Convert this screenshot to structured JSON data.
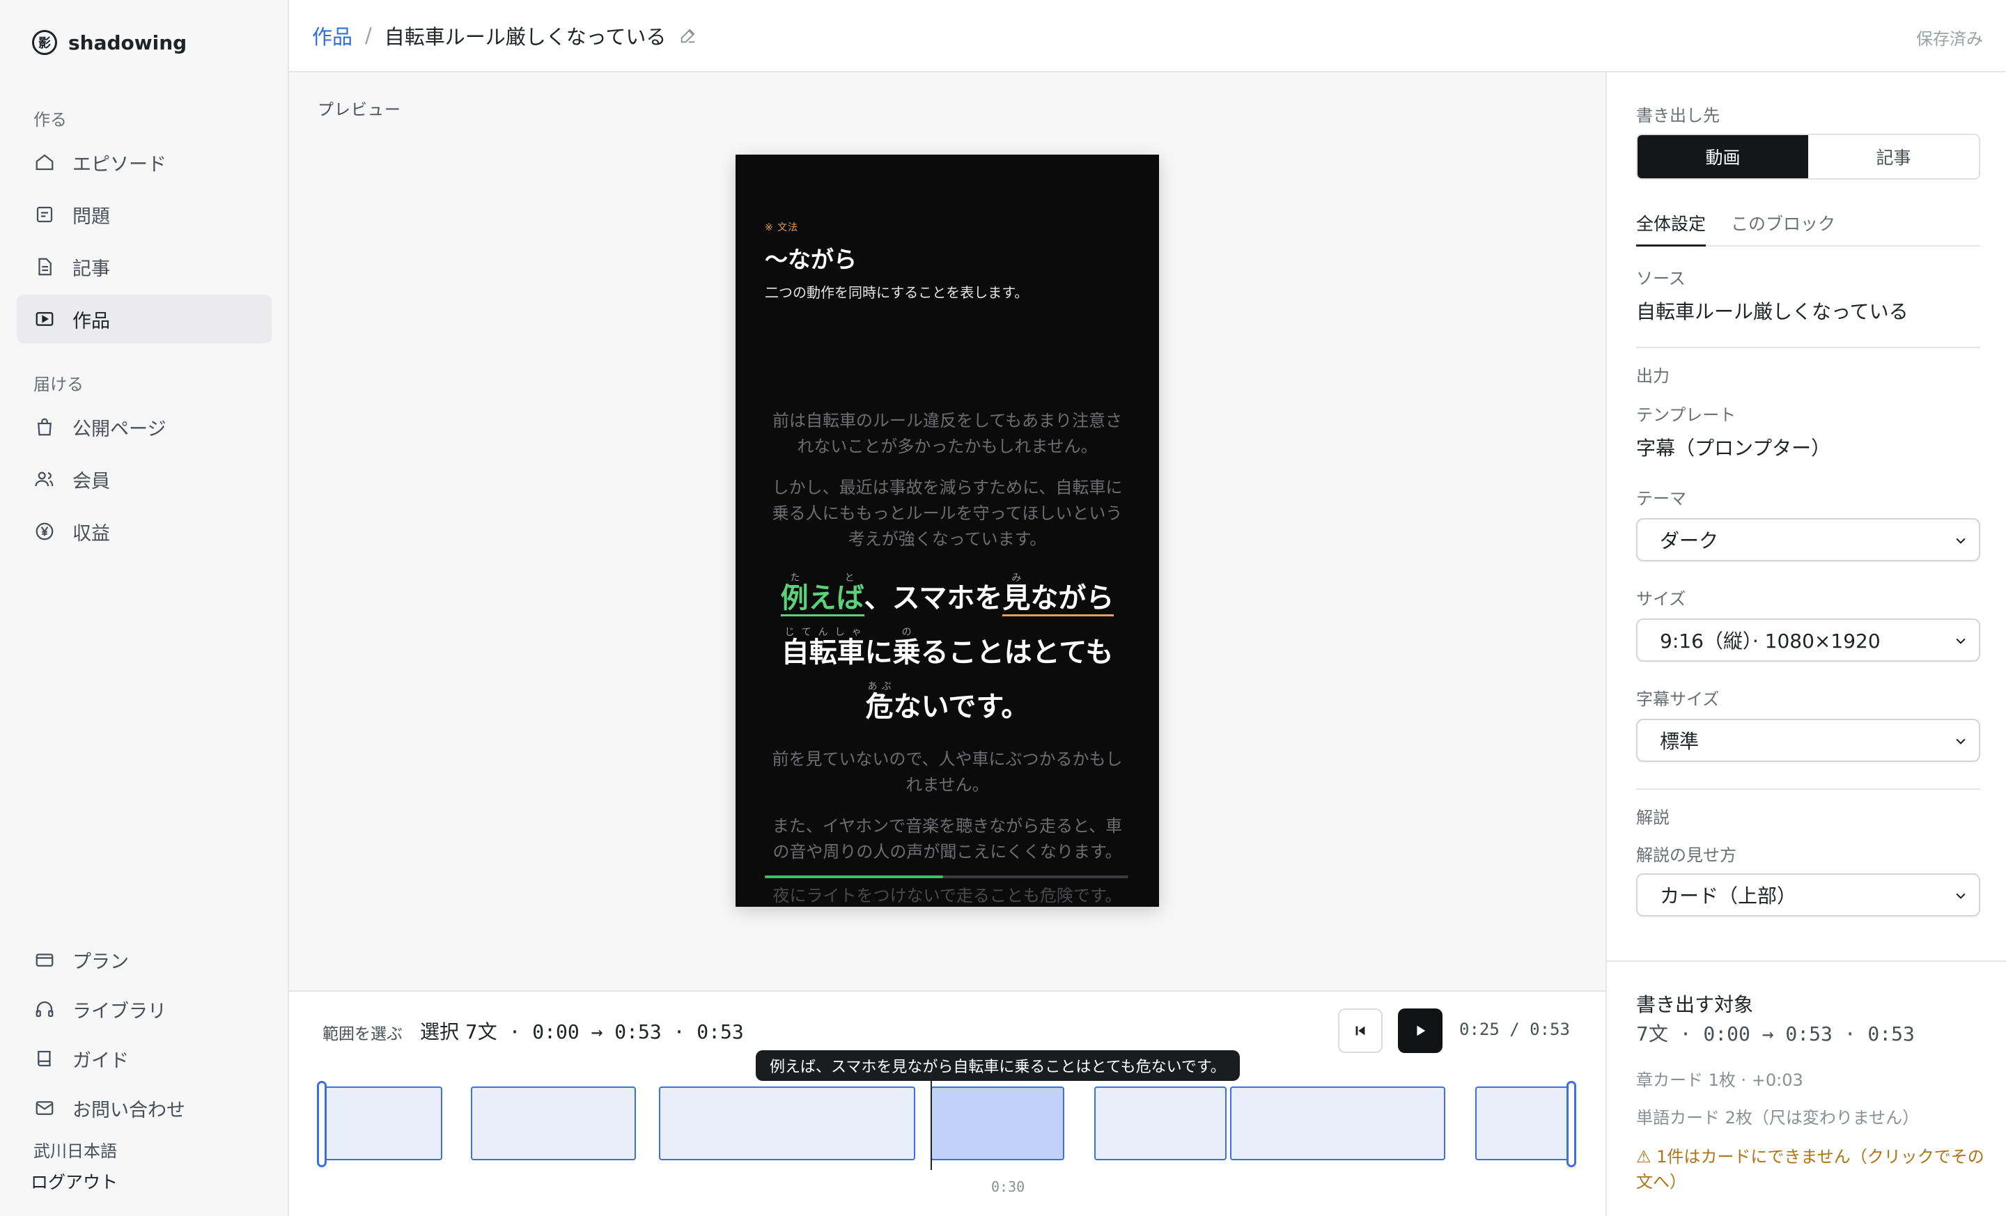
{
  "app": {
    "name": "shadowing",
    "logo_char": "影"
  },
  "sidebar": {
    "section_create": "作る",
    "section_deliver": "届ける",
    "items": [
      {
        "label": "エピソード",
        "icon": "home-icon"
      },
      {
        "label": "問題",
        "icon": "list-icon"
      },
      {
        "label": "記事",
        "icon": "document-icon"
      },
      {
        "label": "作品",
        "icon": "play-square-icon",
        "active": true
      },
      {
        "label": "公開ページ",
        "icon": "bag-icon"
      },
      {
        "label": "会員",
        "icon": "users-icon"
      },
      {
        "label": "収益",
        "icon": "yen-icon"
      }
    ],
    "bottom_items": [
      {
        "label": "プラン",
        "icon": "credit-card-icon"
      },
      {
        "label": "ライブラリ",
        "icon": "headphones-icon"
      },
      {
        "label": "ガイド",
        "icon": "book-icon"
      },
      {
        "label": "お問い合わせ",
        "icon": "mail-icon"
      }
    ],
    "org_name": "武川日本語",
    "logout": "ログアウト"
  },
  "header": {
    "breadcrumb_root": "作品",
    "separator": "/",
    "title": "自転車ルール厳しくなっている",
    "status": "保存済み"
  },
  "preview": {
    "label": "プレビュー",
    "card": {
      "kicker": "※ 文法",
      "title": "〜ながら",
      "desc": "二つの動作を同時にすることを表します。"
    },
    "prev_sentences": [
      "前は自転車のルール違反をしてもあまり注意されないことが多かったかもしれません。",
      "しかし、最近は事故を減らすために、自転車に乗る人にももっとルールを守ってほしいという考えが強くなっています。"
    ],
    "current": {
      "w1": "例えば",
      "w1_ruby": "たと",
      "w2": "、スマホを",
      "w3": "見",
      "w3_ruby": "み",
      "w4": "ながら",
      "w5": "自転車",
      "w5_ruby": "じてんしゃ",
      "w6": "に",
      "w7": "乗",
      "w7_ruby": "の",
      "w8": "ることはとても",
      "w9": "危",
      "w9_ruby": "あぶ",
      "w10": "ないです。"
    },
    "next_sentences": [
      "前を見ていないので、人や車にぶつかるかもしれません。",
      "また、イヤホンで音楽を聴きながら走ると、車の音や周りの人の声が聞こえにくくなります。",
      "夜にライトをつけないで走ることも危険です。"
    ],
    "progress": 0.49
  },
  "timeline": {
    "range_label": "範囲を選ぶ",
    "selected": "選択 7文",
    "range": " · 0:00 → 0:53 · 0:53",
    "time_readout": "0:25 / 0:53",
    "tooltip": "例えば、スマホを見ながら自転車に乗ることはとても危ないです。",
    "tick_label": "0:30"
  },
  "panel": {
    "export_dest_label": "書き出し先",
    "dest_options": [
      "動画",
      "記事"
    ],
    "tabs": [
      "全体設定",
      "このブロック"
    ],
    "source_label": "ソース",
    "source_value": "自転車ルール厳しくなっている",
    "output_label": "出力",
    "template_label": "テンプレート",
    "template_value": "字幕（プロンプター）",
    "theme_label": "テーマ",
    "theme_value": "ダーク",
    "size_label": "サイズ",
    "size_value": "9:16（縦）· 1080×1920",
    "subtitle_size_label": "字幕サイズ",
    "subtitle_size_value": "標準",
    "commentary_label": "解説",
    "commentary_style_label": "解説の見せ方",
    "commentary_style_value": "カード（上部）",
    "export_target_title": "書き出す対象",
    "export_count": "7文",
    "export_range": " · 0:00 → 0:53 · 0:53",
    "chapter_note": "章カード 1枚 · +0:03",
    "word_note": "単語カード 2枚（尺は変わりません）",
    "warning": "⚠ 1件はカードにできません（クリックでその文へ）"
  },
  "colors": {
    "accent_blue": "#3d6fe0",
    "link_blue": "#2f6fd9",
    "highlight_green": "#5bd17a",
    "highlight_orange": "#e3a05a",
    "warning": "#b07416"
  }
}
